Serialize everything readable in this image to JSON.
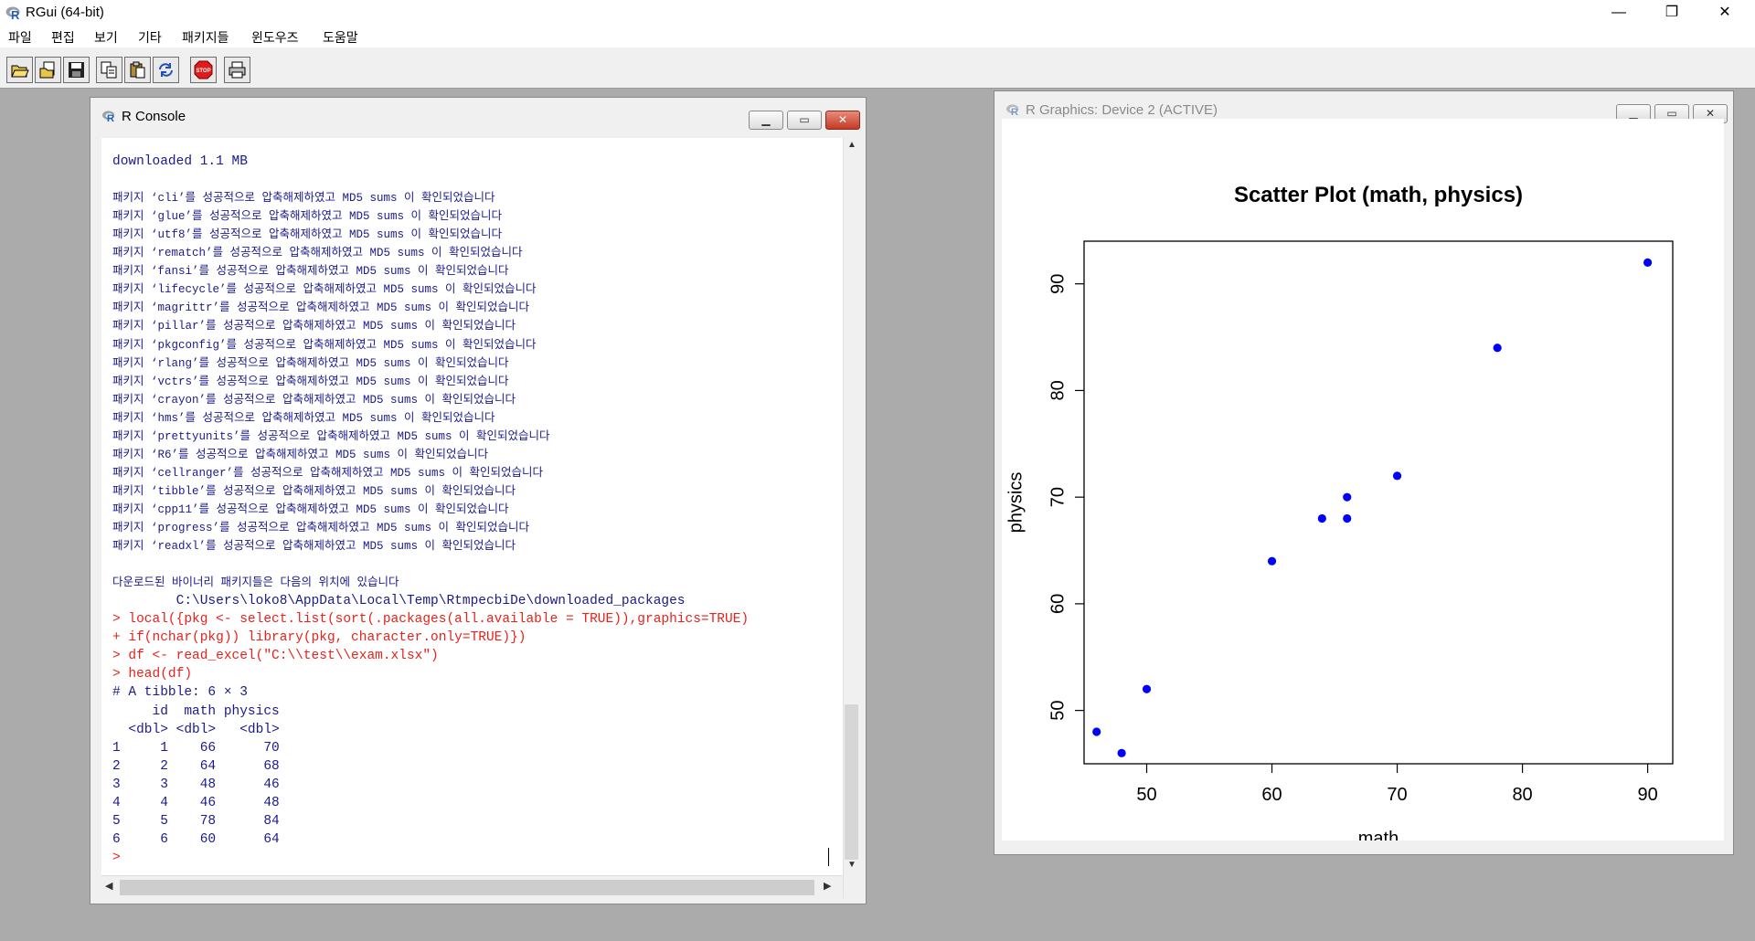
{
  "app": {
    "title": "RGui (64-bit)",
    "window_controls": [
      "—",
      "❐",
      "✕"
    ]
  },
  "menu": [
    "파일",
    "편집",
    "보기",
    "기타",
    "패키지들",
    "윈도우즈",
    "도움말"
  ],
  "toolbar": {
    "buttons": [
      "open-script",
      "load-workspace",
      "save-workspace",
      "copy",
      "paste",
      "copy-paste",
      "stop",
      "print"
    ],
    "stop_label": "STOP"
  },
  "console": {
    "title": "R Console",
    "lines": [
      {
        "text": "downloaded 1.1 MB",
        "color": "blue"
      },
      {
        "text": "",
        "color": "blue"
      },
      {
        "text": "패키지 ‘cli’를 성공적으로 압축해제하였고 MD5 sums 이 확인되었습니다",
        "color": "blue",
        "size": "small"
      },
      {
        "text": "패키지 ‘glue’를 성공적으로 압축해제하였고 MD5 sums 이 확인되었습니다",
        "color": "blue",
        "size": "small"
      },
      {
        "text": "패키지 ‘utf8’를 성공적으로 압축해제하였고 MD5 sums 이 확인되었습니다",
        "color": "blue",
        "size": "small"
      },
      {
        "text": "패키지 ‘rematch’를 성공적으로 압축해제하였고 MD5 sums 이 확인되었습니다",
        "color": "blue",
        "size": "small"
      },
      {
        "text": "패키지 ‘fansi’를 성공적으로 압축해제하였고 MD5 sums 이 확인되었습니다",
        "color": "blue",
        "size": "small"
      },
      {
        "text": "패키지 ‘lifecycle’를 성공적으로 압축해제하였고 MD5 sums 이 확인되었습니다",
        "color": "blue",
        "size": "small"
      },
      {
        "text": "패키지 ‘magrittr’를 성공적으로 압축해제하였고 MD5 sums 이 확인되었습니다",
        "color": "blue",
        "size": "small"
      },
      {
        "text": "패키지 ‘pillar’를 성공적으로 압축해제하였고 MD5 sums 이 확인되었습니다",
        "color": "blue",
        "size": "small"
      },
      {
        "text": "패키지 ‘pkgconfig’를 성공적으로 압축해제하였고 MD5 sums 이 확인되었습니다",
        "color": "blue",
        "size": "small"
      },
      {
        "text": "패키지 ‘rlang’를 성공적으로 압축해제하였고 MD5 sums 이 확인되었습니다",
        "color": "blue",
        "size": "small"
      },
      {
        "text": "패키지 ‘vctrs’를 성공적으로 압축해제하였고 MD5 sums 이 확인되었습니다",
        "color": "blue",
        "size": "small"
      },
      {
        "text": "패키지 ‘crayon’를 성공적으로 압축해제하였고 MD5 sums 이 확인되었습니다",
        "color": "blue",
        "size": "small"
      },
      {
        "text": "패키지 ‘hms’를 성공적으로 압축해제하였고 MD5 sums 이 확인되었습니다",
        "color": "blue",
        "size": "small"
      },
      {
        "text": "패키지 ‘prettyunits’를 성공적으로 압축해제하였고 MD5 sums 이 확인되었습니다",
        "color": "blue",
        "size": "small"
      },
      {
        "text": "패키지 ‘R6’를 성공적으로 압축해제하였고 MD5 sums 이 확인되었습니다",
        "color": "blue",
        "size": "small"
      },
      {
        "text": "패키지 ‘cellranger’를 성공적으로 압축해제하였고 MD5 sums 이 확인되었습니다",
        "color": "blue",
        "size": "small"
      },
      {
        "text": "패키지 ‘tibble’를 성공적으로 압축해제하였고 MD5 sums 이 확인되었습니다",
        "color": "blue",
        "size": "small"
      },
      {
        "text": "패키지 ‘cpp11’를 성공적으로 압축해제하였고 MD5 sums 이 확인되었습니다",
        "color": "blue",
        "size": "small"
      },
      {
        "text": "패키지 ‘progress’를 성공적으로 압축해제하였고 MD5 sums 이 확인되었습니다",
        "color": "blue",
        "size": "small"
      },
      {
        "text": "패키지 ‘readxl’를 성공적으로 압축해제하였고 MD5 sums 이 확인되었습니다",
        "color": "blue",
        "size": "small"
      },
      {
        "text": "",
        "color": "blue"
      },
      {
        "text": "다운로드된 바이너리 패키지들은 다음의 위치에 있습니다",
        "color": "blue",
        "size": "small"
      },
      {
        "text": "        C:\\Users\\loko8\\AppData\\Local\\Temp\\RtmpecbiDe\\downloaded_packages",
        "color": "blue"
      },
      {
        "text": "> local({pkg <- select.list(sort(.packages(all.available = TRUE)),graphics=TRUE)",
        "color": "red"
      },
      {
        "text": "+ if(nchar(pkg)) library(pkg, character.only=TRUE)})",
        "color": "red"
      },
      {
        "text": "> df <- read_excel(\"C:\\\\test\\\\exam.xlsx\")",
        "color": "red"
      },
      {
        "text": "> head(df)",
        "color": "red"
      },
      {
        "text": "# A tibble: 6 × 3",
        "color": "blue"
      },
      {
        "text": "     id  math physics",
        "color": "blue"
      },
      {
        "text": "  <dbl> <dbl>   <dbl>",
        "color": "blue"
      },
      {
        "text": "1     1    66      70",
        "color": "blue"
      },
      {
        "text": "2     2    64      68",
        "color": "blue"
      },
      {
        "text": "3     3    48      46",
        "color": "blue"
      },
      {
        "text": "4     4    46      48",
        "color": "blue"
      },
      {
        "text": "5     5    78      84",
        "color": "blue"
      },
      {
        "text": "6     6    60      64",
        "color": "blue"
      },
      {
        "text": ">",
        "color": "red"
      }
    ]
  },
  "graphics": {
    "title": "R Graphics: Device 2 (ACTIVE)"
  },
  "chart_data": {
    "type": "scatter",
    "title": "Scatter Plot (math, physics)",
    "xlabel": "math",
    "ylabel": "physics",
    "xlim": [
      45,
      92
    ],
    "ylim": [
      45,
      94
    ],
    "xticks": [
      50,
      60,
      70,
      80,
      90
    ],
    "yticks": [
      50,
      60,
      70,
      80,
      90
    ],
    "grid": false,
    "point_color": "#0000ff",
    "points": [
      {
        "x": 46,
        "y": 48
      },
      {
        "x": 48,
        "y": 46
      },
      {
        "x": 50,
        "y": 52
      },
      {
        "x": 60,
        "y": 64
      },
      {
        "x": 64,
        "y": 68
      },
      {
        "x": 66,
        "y": 70
      },
      {
        "x": 66,
        "y": 68
      },
      {
        "x": 70,
        "y": 72
      },
      {
        "x": 78,
        "y": 84
      },
      {
        "x": 90,
        "y": 92
      }
    ]
  }
}
